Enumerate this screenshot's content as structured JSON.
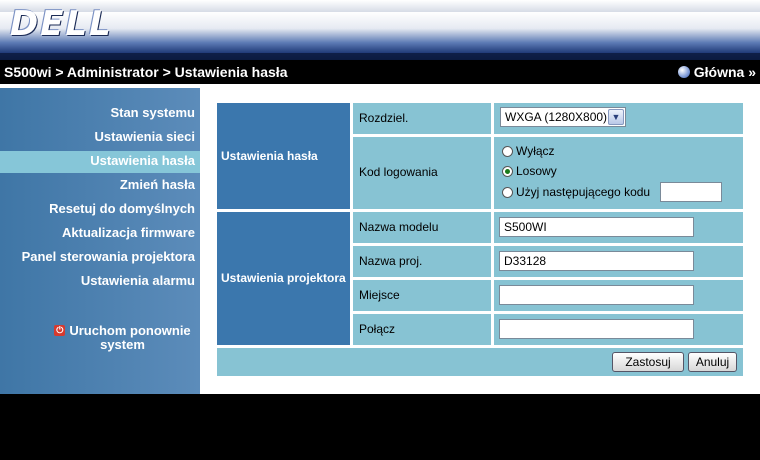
{
  "header": {
    "logo": "DELL"
  },
  "crumb": {
    "path": "S500wi > Administrator > Ustawienia hasła",
    "home": "Główna »"
  },
  "sidebar": {
    "items": [
      {
        "label": "Stan systemu"
      },
      {
        "label": "Ustawienia sieci"
      },
      {
        "label": "Ustawienia hasła",
        "active": true
      },
      {
        "label": "Zmień hasła"
      },
      {
        "label": "Resetuj do domyślnych"
      },
      {
        "label": "Aktualizacja firmware"
      },
      {
        "label": "Panel sterowania projektora"
      },
      {
        "label": "Ustawienia alarmu"
      }
    ],
    "restart": "Uruchom ponownie system"
  },
  "form": {
    "section_password": "Ustawienia hasła",
    "section_projector": "Ustawienia projektora",
    "resolution_label": "Rozdziel.",
    "resolution_value": "WXGA (1280X800)",
    "login_code_label": "Kod logowania",
    "radio_off": "Wyłącz",
    "radio_random": "Losowy",
    "radio_custom": "Użyj następującego kodu",
    "custom_code_value": "",
    "model_name_label": "Nazwa modelu",
    "model_name_value": "S500WI",
    "proj_name_label": "Nazwa proj.",
    "proj_name_value": "D33128",
    "location_label": "Miejsce",
    "location_value": "",
    "contact_label": "Połącz",
    "contact_value": "",
    "apply_button": "Zastosuj",
    "cancel_button": "Anuluj"
  }
}
